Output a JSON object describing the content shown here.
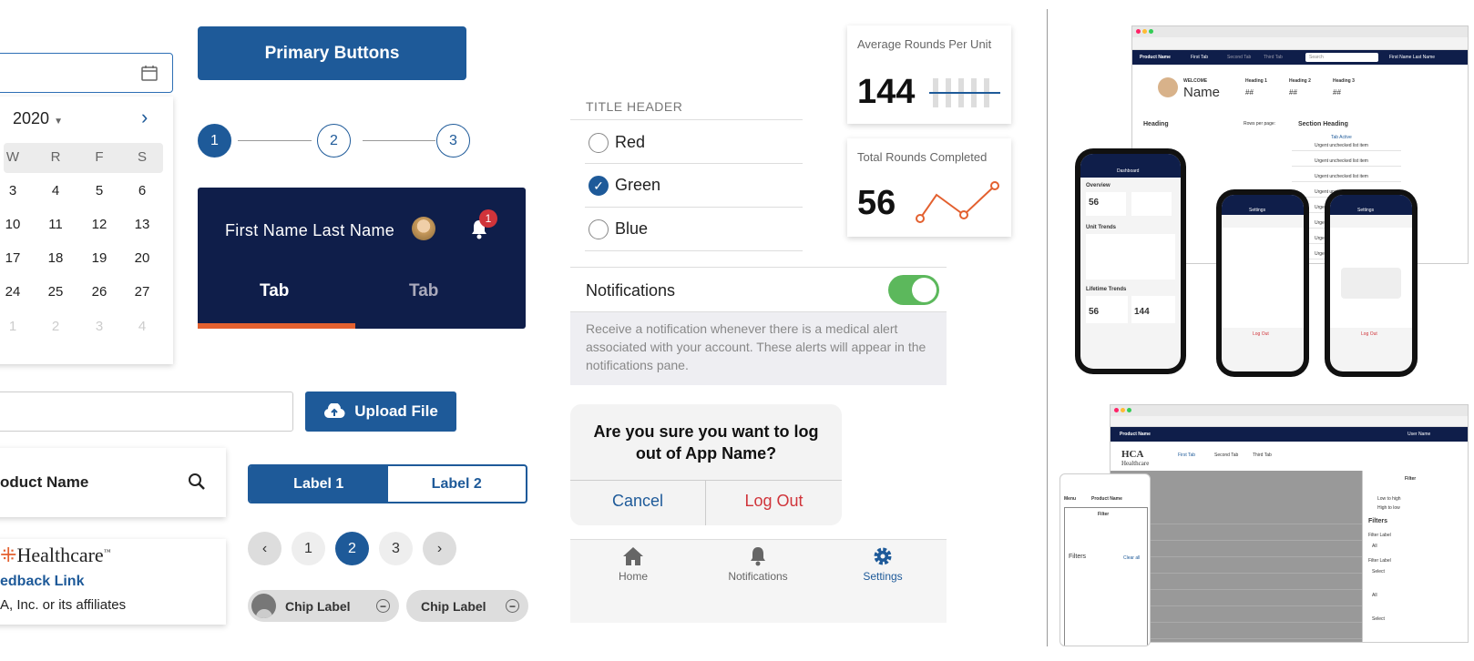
{
  "datepicker": {
    "year_label": "2020",
    "weekdays": [
      "W",
      "R",
      "F",
      "S"
    ],
    "rows": [
      [
        "3",
        "4",
        "5",
        "6"
      ],
      [
        "10",
        "11",
        "12",
        "13"
      ],
      [
        "17",
        "18",
        "19",
        "20"
      ],
      [
        "24",
        "25",
        "26",
        "27"
      ]
    ],
    "next_row": [
      "1",
      "2",
      "3",
      "4"
    ]
  },
  "primary_button": {
    "label": "Primary Buttons"
  },
  "stepper": {
    "steps": [
      "1",
      "2",
      "3"
    ],
    "active": 1
  },
  "navbar": {
    "user_name": "First Name Last Name",
    "badge_count": "1",
    "tabs": [
      "Tab",
      "Tab"
    ]
  },
  "upload": {
    "label": "Upload File"
  },
  "header_search": {
    "product_name": "oduct Name"
  },
  "segmented": {
    "options": [
      "Label 1",
      "Label 2"
    ]
  },
  "pagination": {
    "pages": [
      "1",
      "2",
      "3"
    ],
    "current": "2"
  },
  "footer": {
    "logo_text": "Healthcare",
    "link_text": "edback Link",
    "copyright": "A, Inc. or its affiliates"
  },
  "chips": [
    {
      "label": "Chip Label"
    },
    {
      "label": "Chip Label"
    }
  ],
  "radio_group": {
    "title": "TITLE HEADER",
    "options": [
      "Red",
      "Green",
      "Blue"
    ],
    "selected": "Green"
  },
  "notifications": {
    "label": "Notifications",
    "enabled": true,
    "description": "Receive a notification whenever there is a medical alert associated with your account. These alerts will appear in the notifications pane."
  },
  "kpi_cards": [
    {
      "title": "Average Rounds Per Unit",
      "value": "144"
    },
    {
      "title": "Total Rounds Completed",
      "value": "56"
    }
  ],
  "dialog": {
    "message": "Are you sure you want to log out of App Name?",
    "cancel": "Cancel",
    "confirm": "Log Out"
  },
  "tab_bar": [
    {
      "label": "Home"
    },
    {
      "label": "Notifications"
    },
    {
      "label": "Settings"
    }
  ],
  "preview": {
    "product_name": "Product Name",
    "tabs": [
      "First Tab",
      "Second Tab",
      "Third Tab"
    ],
    "search": "Search",
    "user": "First Name Last Name",
    "welcome": "WELCOME",
    "name": "Name",
    "headings": [
      "Heading 1",
      "Heading 2",
      "Heading 3"
    ],
    "hash": "##",
    "heading": "Heading",
    "section_heading": "Section Heading",
    "tab_active": "Tab Active",
    "rows_per_page": "Rows per page:",
    "urgent": "Urgent unchecked list item",
    "dashboard": "Dashboard",
    "overview": "Overview",
    "unit_trends": "Unit Trends",
    "lifetime_trends": "Lifetime Trends",
    "settings": "Settings",
    "log_out": "Log Out",
    "user_name": "User Name",
    "filter": "Filter",
    "filters": "Filters",
    "clear_all": "Clear all",
    "low_to_high": "Low to high",
    "high_to_low": "High to low",
    "filter_label": "Filter Label",
    "select": "Select",
    "all": "All",
    "hca": "HCA",
    "healthcare": "Healthcare",
    "menu": "Menu"
  },
  "colors": {
    "primary": "#1e5a99",
    "navy": "#0f1e4a",
    "accent": "#e3602f",
    "toggle": "#5cb85c",
    "danger": "#d0343a"
  }
}
